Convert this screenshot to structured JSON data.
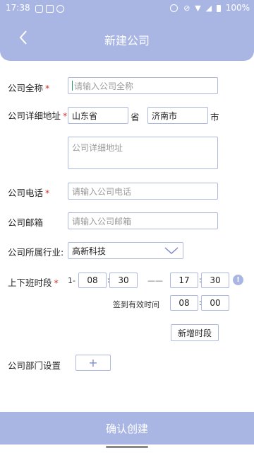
{
  "status_bar": {
    "time": "17:38",
    "battery": "100%"
  },
  "header": {
    "title": "新建公司"
  },
  "form": {
    "company_name": {
      "label": "公司全称",
      "required_mark": "*",
      "placeholder": "请输入公司全称"
    },
    "address": {
      "label": "公司详细地址",
      "required_mark": "*",
      "province": "山东省",
      "province_suffix": "省",
      "city": "济南市",
      "city_suffix": "市",
      "detail_placeholder": "公司详细地址"
    },
    "phone": {
      "label": "公司电话",
      "required_mark": "*",
      "placeholder": "请输入公司电话"
    },
    "email": {
      "label": "公司邮箱",
      "placeholder": "请输入公司邮箱"
    },
    "industry": {
      "label": "公司所属行业:",
      "value": "高新科技"
    },
    "work_time": {
      "label": "上下班时段",
      "required_mark": "*",
      "index": "1-",
      "start_hour": "08",
      "start_min": "30",
      "separator": "——",
      "end_hour": "17",
      "end_min": "30",
      "colon": ":",
      "checkin_label": "签到有效时间",
      "checkin_hour": "08",
      "checkin_min": "00",
      "info_icon": "!"
    },
    "add_period_button": "新增时段",
    "department": {
      "label": "公司部门设置",
      "add_symbol": "+"
    }
  },
  "footer": {
    "confirm_button": "确认创建"
  }
}
